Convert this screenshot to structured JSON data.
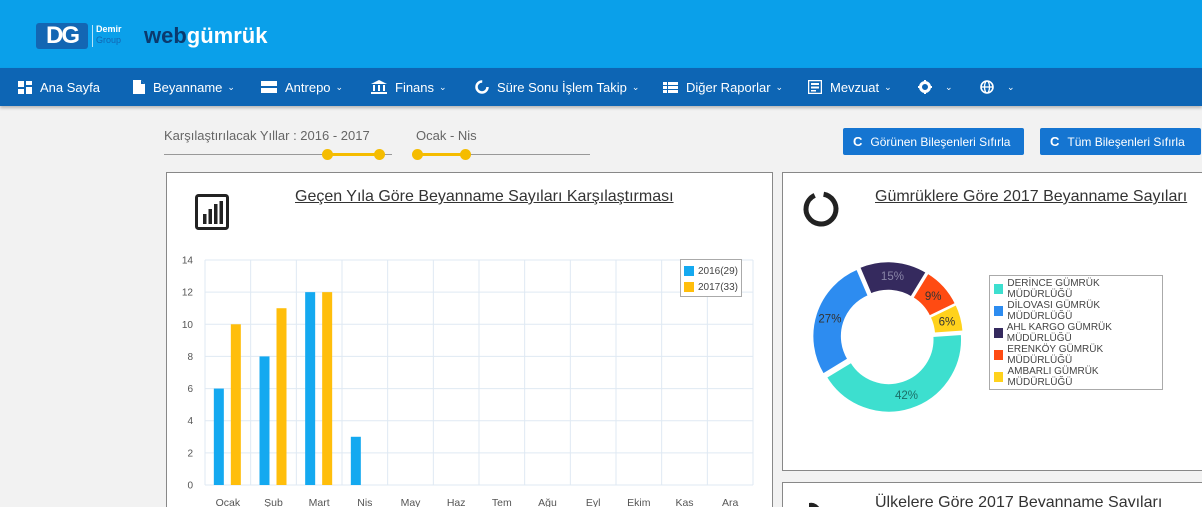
{
  "header": {
    "logo_mark": "DG",
    "logo_line1": "Demir",
    "logo_line2": "Group",
    "brand_prefix": "web",
    "brand_suffix": "gümrük",
    "bg_color": "#0aa0ea"
  },
  "nav": {
    "items": [
      {
        "label": "Ana Sayfa",
        "icon": "dashboard-icon",
        "dropdown": false
      },
      {
        "label": "Beyanname",
        "icon": "document-icon",
        "dropdown": true
      },
      {
        "label": "Antrepo",
        "icon": "warehouse-icon",
        "dropdown": true
      },
      {
        "label": "Finans",
        "icon": "bank-icon",
        "dropdown": true
      },
      {
        "label": "Süre Sonu İşlem Takip",
        "icon": "circle-spinner-icon",
        "dropdown": true
      },
      {
        "label": "Diğer Raporlar",
        "icon": "table-icon",
        "dropdown": true
      },
      {
        "label": "Mevzuat",
        "icon": "book-icon",
        "dropdown": true
      },
      {
        "label": "",
        "icon": "gear-icon",
        "dropdown": true
      },
      {
        "label": "",
        "icon": "globe-icon",
        "dropdown": true
      }
    ],
    "caret": "⌄"
  },
  "filters": {
    "years_label": "Karşılaştırılacak Yıllar : 2016 - 2017",
    "months_label": "Ocak - Nis",
    "accent_color": "#f5bc00"
  },
  "buttons": {
    "reset_visible": "Görünen Bileşenleri Sıfırla",
    "reset_all": "Tüm Bileşenleri Sıfırla",
    "refresh_glyph": "C"
  },
  "bar_card": {
    "title": "Geçen Yıla Göre Beyanname Sayıları Karşılaştırması",
    "icon": "bar-chart-icon"
  },
  "donut_card": {
    "title": "Gümrüklere Göre 2017 Beyanname Sayıları",
    "icon": "donut-icon"
  },
  "country_card": {
    "title": "Ülkelere Göre 2017 Beyanname Sayıları",
    "icon": "pie-icon"
  },
  "chart_data": [
    {
      "type": "bar",
      "categories": [
        "Ocak",
        "Şub",
        "Mart",
        "Nis",
        "May",
        "Haz",
        "Tem",
        "Ağu",
        "Eyl",
        "Ekim",
        "Kas",
        "Ara"
      ],
      "series": [
        {
          "name": "2016(29)",
          "color": "#14a9f0",
          "values": [
            6,
            8,
            12,
            3,
            0,
            0,
            0,
            0,
            0,
            0,
            0,
            0
          ]
        },
        {
          "name": "2017(33)",
          "color": "#ffbe0b",
          "values": [
            10,
            11,
            12,
            0,
            0,
            0,
            0,
            0,
            0,
            0,
            0,
            0
          ]
        }
      ],
      "yticks": [
        0,
        2,
        4,
        6,
        8,
        10,
        12,
        14
      ],
      "ylim": [
        0,
        14
      ],
      "grid": true,
      "legend": "top-right"
    },
    {
      "type": "pie",
      "slices": [
        {
          "label": "DERİNCE GÜMRÜK MÜDÜRLÜĞÜ",
          "value": 42,
          "text": "42%",
          "color": "#3ddfcf"
        },
        {
          "label": "DİLOVASI GÜMRÜK MÜDÜRLÜĞÜ",
          "value": 27,
          "text": "27%",
          "color": "#2d8cf0"
        },
        {
          "label": "AHL KARGO GÜMRÜK MÜDÜRLÜĞÜ",
          "value": 15,
          "text": "15%",
          "color": "#352a5e"
        },
        {
          "label": "ERENKÖY GÜMRÜK MÜDÜRLÜĞÜ",
          "value": 9,
          "text": "9%",
          "color": "#ff4b12"
        },
        {
          "label": "AMBARLI GÜMRÜK MÜDÜRLÜĞÜ",
          "value": 6,
          "text": "6%",
          "color": "#ffd21c"
        }
      ],
      "legend": "right"
    }
  ]
}
